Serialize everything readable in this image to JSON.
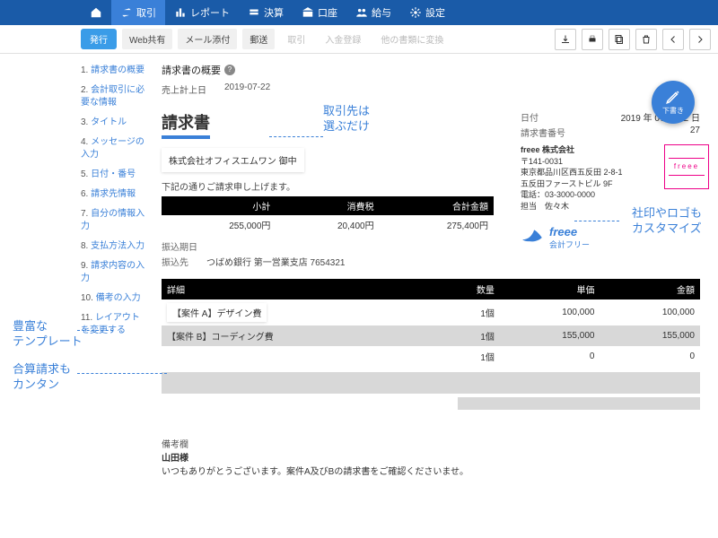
{
  "nav": {
    "home_label": "",
    "items": [
      {
        "icon": "swap",
        "label": "取引"
      },
      {
        "icon": "chart",
        "label": "レポート"
      },
      {
        "icon": "balance",
        "label": "決算"
      },
      {
        "icon": "bank",
        "label": "口座"
      },
      {
        "icon": "people",
        "label": "給与"
      },
      {
        "icon": "gear",
        "label": "設定"
      }
    ]
  },
  "subbar": {
    "primary": "発行",
    "chips": [
      "Web共有",
      "メール添付",
      "郵送"
    ],
    "ghost_chips": [
      "取引",
      "入金登録",
      "他の書類に変換"
    ],
    "right_icons": [
      "download-icon",
      "print-icon",
      "copy-icon",
      "trash-icon",
      "chevron-left-icon",
      "chevron-right-icon"
    ]
  },
  "sidebar": {
    "items": [
      "請求書の概要",
      "会計取引に必要な情報",
      "タイトル",
      "メッセージの入力",
      "日付・番号",
      "請求先情報",
      "自分の情報入力",
      "支払方法入力",
      "請求内容の入力",
      "備考の入力",
      "レイアウトを変更する"
    ]
  },
  "section_title": "請求書の概要",
  "meta": {
    "sales_date_label": "売上計上日",
    "sales_date": "2019-07-22"
  },
  "invoice_title": "請求書",
  "recipient": "株式会社オフィスエムワン 御中",
  "sub_note": "下記の通りご請求申し上げます。",
  "totals": {
    "headers": [
      "小計",
      "消費税",
      "合計金額"
    ],
    "values": [
      "255,000円",
      "20,400円",
      "275,400円"
    ]
  },
  "bank": {
    "due_label": "振込期日",
    "due": "",
    "dest_label": "振込先",
    "dest": "つばめ銀行 第一営業支店 7654321"
  },
  "info_right": {
    "date_label": "日付",
    "date": "2019 年 07 月 22 日",
    "num_label": "請求書番号",
    "num": "27"
  },
  "company": {
    "name": "freee 株式会社",
    "zip": "〒141-0031",
    "addr1": "東京都品川区西五反田 2-8-1",
    "addr2": "五反田ファーストビル 9F",
    "tel": "電話：03-3000-0000",
    "person_label": "担当",
    "person": "佐々木",
    "stamp_text": "freee"
  },
  "logo": {
    "text": "freee",
    "sub": "会計フリー"
  },
  "items": {
    "headers": [
      "詳細",
      "数量",
      "単価",
      "金額"
    ],
    "rows": [
      {
        "detail": "【案件 A】デザイン費",
        "qty": "1個",
        "unit": "100,000",
        "amount": "100,000",
        "pop": true
      },
      {
        "detail": "【案件 B】コーディング費",
        "qty": "1個",
        "unit": "155,000",
        "amount": "155,000",
        "hl": true
      },
      {
        "detail": "",
        "qty": "1個",
        "unit": "0",
        "amount": "0"
      }
    ]
  },
  "remarks": {
    "header": "備考欄",
    "name": "山田様",
    "body": "いつもありがとうございます。案件A及びBの請求書をご確認くださいませ。"
  },
  "callouts": {
    "c1": "取引先は\n選ぶだけ",
    "c2": "社印やロゴも\nカスタマイズ",
    "c3": "豊富な\nテンプレート",
    "c4": "合算請求も\nカンタン"
  },
  "fab": {
    "label": "下書き"
  }
}
